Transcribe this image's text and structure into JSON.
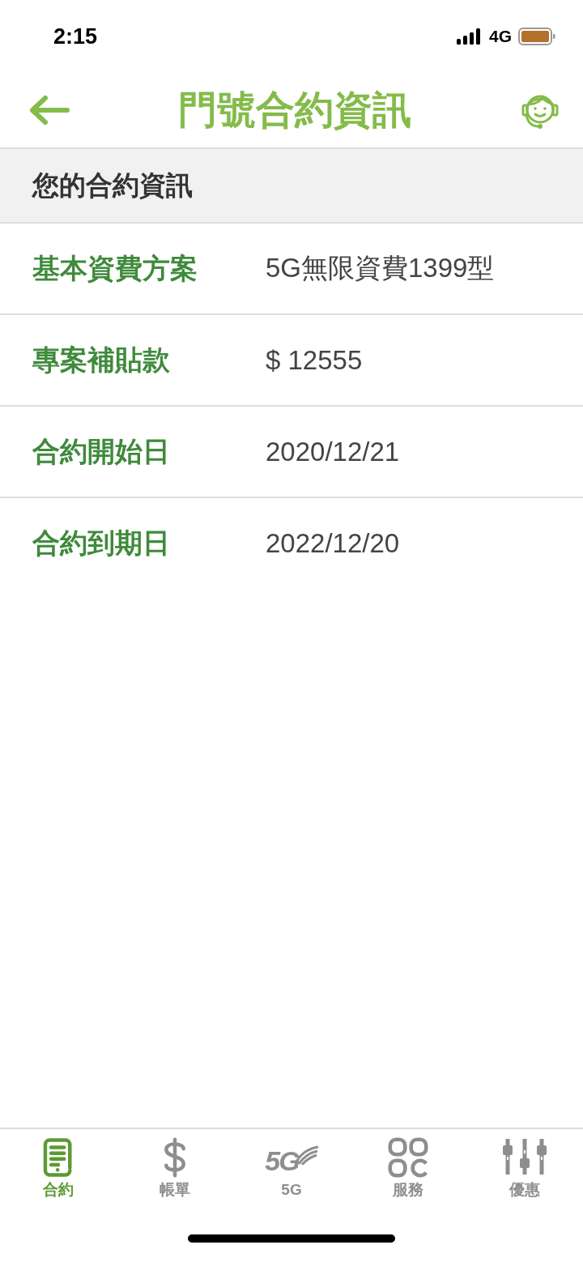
{
  "status_bar": {
    "time": "2:15",
    "network": "4G"
  },
  "header": {
    "title": "門號合約資訊"
  },
  "section": {
    "title": "您的合約資訊"
  },
  "rows": [
    {
      "label": "基本資費方案",
      "value": "5G無限資費1399型"
    },
    {
      "label": "專案補貼款",
      "value": "$ 12555"
    },
    {
      "label": "合約開始日",
      "value": "2020/12/21"
    },
    {
      "label": "合約到期日",
      "value": "2022/12/20"
    }
  ],
  "tabs": [
    {
      "kind": "contract",
      "label": "合約",
      "selected": true
    },
    {
      "kind": "bill",
      "label": "帳單",
      "selected": false
    },
    {
      "kind": "fiveg",
      "label": "5G",
      "icon_text": "5G",
      "selected": false
    },
    {
      "kind": "service",
      "label": "服務",
      "selected": false
    },
    {
      "kind": "offer",
      "label": "優惠",
      "selected": false
    }
  ]
}
